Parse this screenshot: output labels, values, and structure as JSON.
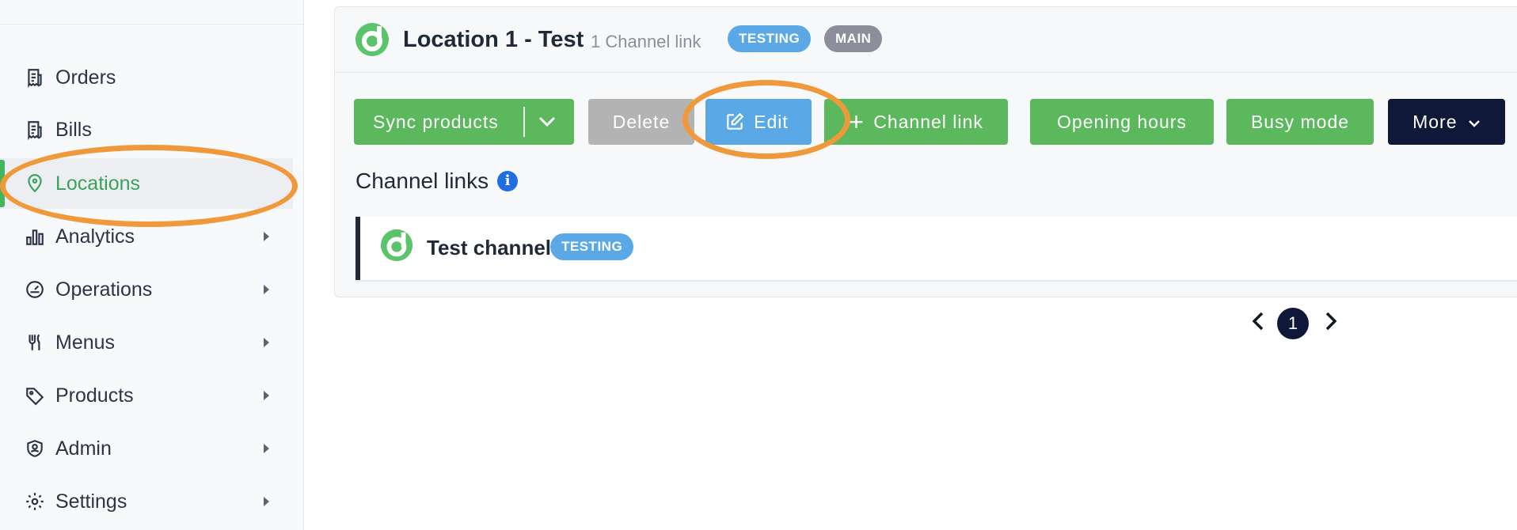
{
  "sidebar": {
    "items": [
      {
        "label": "Orders",
        "icon": "receipt-icon",
        "has_submenu": false
      },
      {
        "label": "Bills",
        "icon": "receipt-icon",
        "has_submenu": false
      },
      {
        "label": "Locations",
        "icon": "map-pin-icon",
        "has_submenu": false,
        "active": true
      },
      {
        "label": "Analytics",
        "icon": "bar-chart-icon",
        "has_submenu": true
      },
      {
        "label": "Operations",
        "icon": "gauge-icon",
        "has_submenu": true
      },
      {
        "label": "Menus",
        "icon": "fork-knife-icon",
        "has_submenu": true
      },
      {
        "label": "Products",
        "icon": "tag-icon",
        "has_submenu": true
      },
      {
        "label": "Admin",
        "icon": "shield-user-icon",
        "has_submenu": true
      },
      {
        "label": "Settings",
        "icon": "gear-icon",
        "has_submenu": true
      }
    ]
  },
  "location": {
    "title": "Location 1 - Test",
    "subtitle": "1 Channel link",
    "badges": [
      "TESTING",
      "MAIN"
    ]
  },
  "actions": {
    "sync_products": "Sync products",
    "delete": "Delete",
    "edit": "Edit",
    "channel_link": "Channel link",
    "opening_hours": "Opening hours",
    "busy_mode": "Busy mode",
    "more": "More"
  },
  "channel_links": {
    "heading": "Channel links",
    "items": [
      {
        "name": "Test channel",
        "badge": "TESTING"
      }
    ]
  },
  "pagination": {
    "current_page": "1"
  },
  "colors": {
    "accent_green": "#5cb85c",
    "active_green": "#3aa35a",
    "badge_blue": "#5aa9e6",
    "badge_grey": "#8a8f99",
    "navy": "#0f1838",
    "highlight_orange": "#f0993a"
  }
}
